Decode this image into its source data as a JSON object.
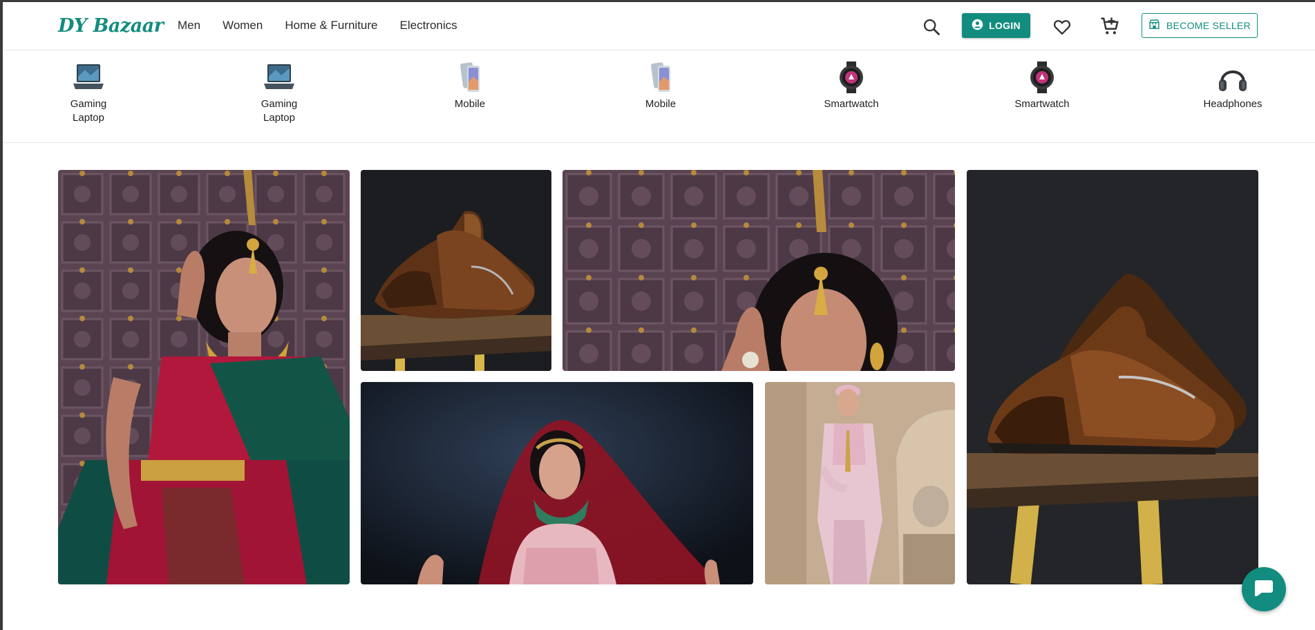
{
  "brand": {
    "logo_text": "DY Bazaar",
    "accent_color": "#128c7e"
  },
  "nav": {
    "items": [
      "Men",
      "Women",
      "Home & Furniture",
      "Electronics"
    ]
  },
  "header_actions": {
    "search_icon": "search-icon",
    "login_label": "LOGIN",
    "wishlist_icon": "heart-icon",
    "cart_icon": "cart-plus-icon",
    "seller_label": "BECOME SELLER"
  },
  "categories": [
    {
      "label": "Gaming Laptop",
      "thumb": "laptop"
    },
    {
      "label": "Gaming Laptop",
      "thumb": "laptop"
    },
    {
      "label": "Mobile",
      "thumb": "phone"
    },
    {
      "label": "Mobile",
      "thumb": "phone"
    },
    {
      "label": "Smartwatch",
      "thumb": "watch"
    },
    {
      "label": "Smartwatch",
      "thumb": "watch"
    },
    {
      "label": "Headphones",
      "thumb": "headphones"
    }
  ],
  "gallery": {
    "tiles": [
      {
        "subject": "woman-in-saree-jewellery"
      },
      {
        "subject": "brown-loafer-on-stool"
      },
      {
        "subject": "woman-jewellery-closeup"
      },
      {
        "subject": "brown-loafer-on-stool-large"
      },
      {
        "subject": "bride-red-veil"
      },
      {
        "subject": "man-pink-sherwani"
      }
    ]
  },
  "chat": {
    "icon": "chat-bubble-icon"
  }
}
